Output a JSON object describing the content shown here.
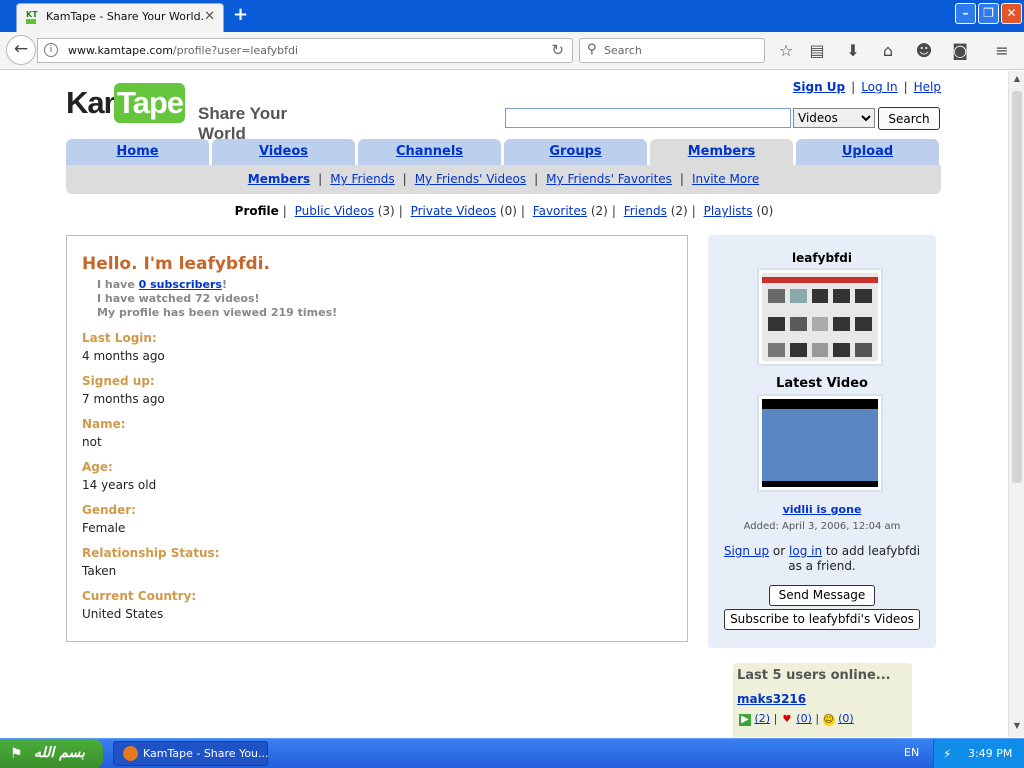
{
  "browser": {
    "tab_title": "KamTape - Share Your World.",
    "url_host": "www.kamtape.com",
    "url_path": "/profile?user=leafybfdi",
    "search_placeholder": "Search"
  },
  "site": {
    "logo_kam": "Kam",
    "logo_tape": "Tape",
    "tagline": "Share Your World",
    "top_links": [
      "Sign Up",
      "Log In",
      "Help"
    ],
    "search_select_value": "Videos",
    "search_button": "Search",
    "nav_tabs": [
      "Home",
      "Videos",
      "Channels",
      "Groups",
      "Members",
      "Upload"
    ],
    "sub_nav": [
      "Members",
      "My Friends",
      "My Friends' Videos",
      "My Friends' Favorites",
      "Invite More"
    ]
  },
  "profile_nav": {
    "current": "Profile",
    "items": [
      {
        "label": "Public Videos",
        "count": "(3)"
      },
      {
        "label": "Private Videos",
        "count": "(0)"
      },
      {
        "label": "Favorites",
        "count": "(2)"
      },
      {
        "label": "Friends",
        "count": "(2)"
      },
      {
        "label": "Playlists",
        "count": "(0)"
      }
    ]
  },
  "profile": {
    "hello": "Hello. I'm leafybfdi.",
    "i_have": "I have",
    "subscribers_link": "0 subscribers",
    "subscribers_end": "!",
    "watched": "I have watched 72 videos!",
    "viewed": "My profile has been viewed 219 times!",
    "fields": [
      {
        "label": "Last Login:",
        "value": "4 months ago"
      },
      {
        "label": "Signed up:",
        "value": "7 months ago"
      },
      {
        "label": "Name:",
        "value": "not"
      },
      {
        "label": "Age:",
        "value": "14 years old"
      },
      {
        "label": "Gender:",
        "value": "Female"
      },
      {
        "label": "Relationship Status:",
        "value": "Taken"
      },
      {
        "label": "Current Country:",
        "value": "United States"
      }
    ]
  },
  "sidebar": {
    "username": "leafybfdi",
    "latest_video_heading": "Latest Video",
    "video_title": "vidlii is gone",
    "video_added": "Added: April 3, 2006, 12:04 am",
    "signup_link": "Sign up",
    "or": "or",
    "login_link": "log in",
    "add_friend_text": "to add leafybfdi as a friend.",
    "send_message": "Send Message",
    "subscribe": "Subscribe to leafybfdi's Videos"
  },
  "online": {
    "heading": "Last 5 users online...",
    "user": "maks3216",
    "videos_count": "(2)",
    "favorites_count": "(0)",
    "friends_count": "(0)"
  },
  "taskbar": {
    "start_label": "بسم الله",
    "task_item": "KamTape - Share You...",
    "lang": "EN",
    "clock": "3:49 PM"
  }
}
